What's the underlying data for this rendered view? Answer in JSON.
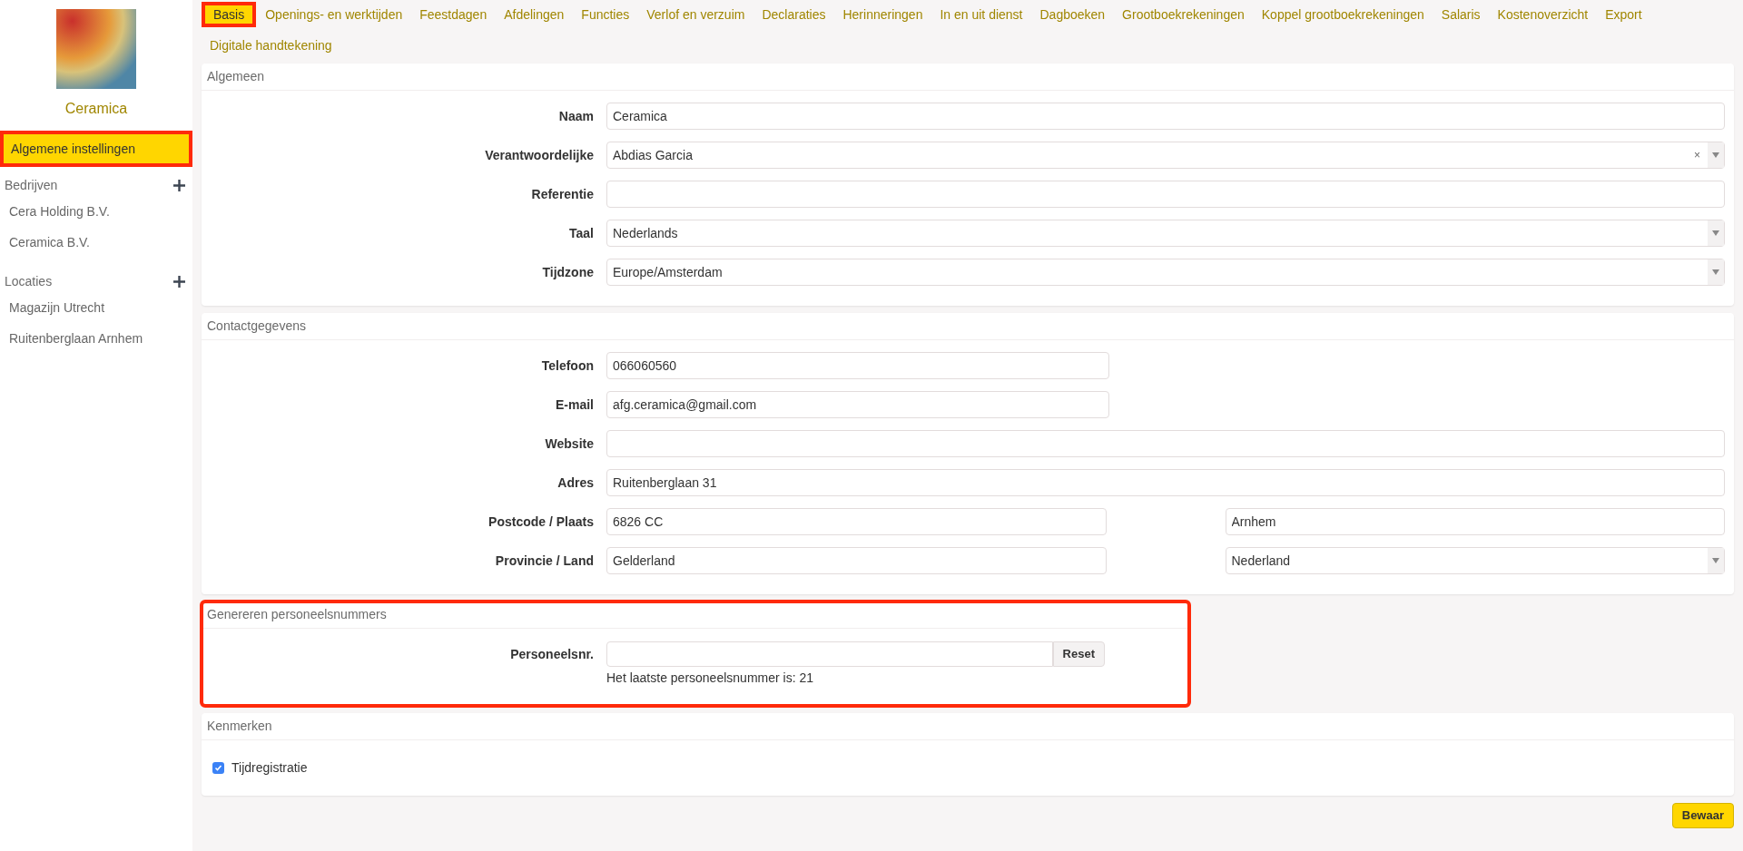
{
  "sidebar": {
    "logo_caption": "Ceramica",
    "items": [
      {
        "label": "Algemene instellingen",
        "selected": true,
        "highlighted": true
      }
    ],
    "groups": [
      {
        "title": "Bedrijven",
        "items": [
          {
            "label": "Cera Holding B.V.",
            "selected": false
          },
          {
            "label": "Ceramica B.V.",
            "selected": false
          }
        ]
      },
      {
        "title": "Locaties",
        "items": [
          {
            "label": "Magazijn Utrecht",
            "selected": false
          },
          {
            "label": "Ruitenberglaan Arnhem",
            "selected": false
          }
        ]
      }
    ]
  },
  "tabs": [
    {
      "label": "Basis",
      "selected": true,
      "highlighted": true
    },
    {
      "label": "Openings- en werktijden",
      "selected": false,
      "highlighted": false
    },
    {
      "label": "Feestdagen",
      "selected": false,
      "highlighted": false
    },
    {
      "label": "Afdelingen",
      "selected": false,
      "highlighted": false
    },
    {
      "label": "Functies",
      "selected": false,
      "highlighted": false
    },
    {
      "label": "Verlof en verzuim",
      "selected": false,
      "highlighted": false
    },
    {
      "label": "Declaraties",
      "selected": false,
      "highlighted": false
    },
    {
      "label": "Herinneringen",
      "selected": false,
      "highlighted": false
    },
    {
      "label": "In en uit dienst",
      "selected": false,
      "highlighted": false
    },
    {
      "label": "Dagboeken",
      "selected": false,
      "highlighted": false
    },
    {
      "label": "Grootboekrekeningen",
      "selected": false,
      "highlighted": false
    },
    {
      "label": "Koppel grootboekrekeningen",
      "selected": false,
      "highlighted": false
    },
    {
      "label": "Salaris",
      "selected": false,
      "highlighted": false
    },
    {
      "label": "Kostenoverzicht",
      "selected": false,
      "highlighted": false
    },
    {
      "label": "Export",
      "selected": false,
      "highlighted": false
    },
    {
      "label": "Digitale handtekening",
      "selected": false,
      "highlighted": false
    }
  ],
  "sections": [
    {
      "kind": "form",
      "title": "Algemeen",
      "highlighted": false,
      "rows": [
        {
          "label": "Naam",
          "kind": "long",
          "fields": [
            {
              "kind": "text",
              "value": "Ceramica"
            }
          ]
        },
        {
          "label": "Verantwoordelijke",
          "kind": "long",
          "fields": [
            {
              "kind": "select",
              "value": "Abdias Garcia",
              "clear": "×"
            }
          ]
        },
        {
          "label": "Referentie",
          "kind": "long",
          "fields": [
            {
              "kind": "text"
            }
          ]
        },
        {
          "label": "Taal",
          "kind": "long",
          "fields": [
            {
              "kind": "select",
              "value": "Nederlands"
            }
          ]
        },
        {
          "label": "Tijdzone",
          "kind": "long",
          "fields": [
            {
              "kind": "select",
              "value": "Europe/Amsterdam"
            }
          ]
        }
      ]
    },
    {
      "kind": "form",
      "title": "Contactgegevens",
      "highlighted": false,
      "rows": [
        {
          "label": "Telefoon",
          "kind": "short",
          "fields": [
            {
              "kind": "text",
              "value": "066060560"
            }
          ]
        },
        {
          "label": "E-mail",
          "kind": "short",
          "fields": [
            {
              "kind": "text",
              "value": "afg.ceramica@gmail.com"
            }
          ]
        },
        {
          "label": "Website",
          "kind": "long",
          "fields": [
            {
              "kind": "text"
            }
          ]
        },
        {
          "label": "Adres",
          "kind": "long",
          "fields": [
            {
              "kind": "text",
              "value": "Ruitenberglaan 31"
            }
          ]
        },
        {
          "label": "Postcode / Plaats",
          "kind": "pair",
          "fields": [
            {
              "kind": "text",
              "value": "6826 CC"
            },
            {
              "kind": "text",
              "value": "Arnhem"
            }
          ]
        },
        {
          "label": "Provincie / Land",
          "kind": "pair",
          "fields": [
            {
              "kind": "text",
              "value": "Gelderland"
            },
            {
              "kind": "select",
              "value": "Nederland"
            }
          ]
        }
      ]
    },
    {
      "kind": "number",
      "title": "Genereren personeelsnummers",
      "highlighted": true,
      "label": "Personeelsnr.",
      "button": "Reset",
      "help": "Het laatste personeelsnummer is: 21"
    },
    {
      "kind": "checks",
      "title": "Kenmerken",
      "highlighted": false,
      "items": [
        {
          "label": "Tijdregistratie",
          "checked": true
        }
      ]
    }
  ],
  "save_button": "Bewaar"
}
